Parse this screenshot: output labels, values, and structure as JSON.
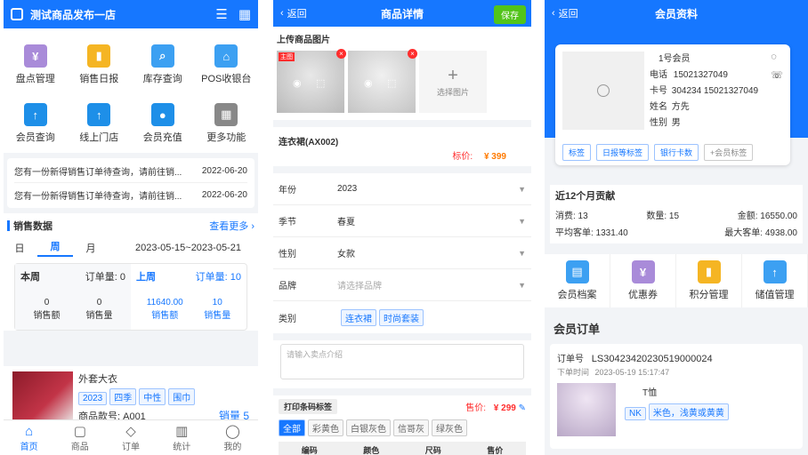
{
  "p1": {
    "title": "测试商品发布一店",
    "grid": [
      {
        "label": "盘点管理",
        "icon": "inventory-icon",
        "color": "#a98bd9",
        "glyph": "¥"
      },
      {
        "label": "销售日报",
        "icon": "daily-report-icon",
        "color": "#f5b523",
        "glyph": "▮"
      },
      {
        "label": "库存查询",
        "icon": "stock-search-icon",
        "color": "#3ca0f2",
        "glyph": "⌕"
      },
      {
        "label": "POS收银台",
        "icon": "pos-icon",
        "color": "#3ca0f2",
        "glyph": "⌂"
      },
      {
        "label": "会员查询",
        "icon": "member-search-icon",
        "color": "#1e8fe8",
        "glyph": "↑"
      },
      {
        "label": "线上门店",
        "icon": "online-store-icon",
        "color": "#1e8fe8",
        "glyph": "↑"
      },
      {
        "label": "会员充值",
        "icon": "recharge-icon",
        "color": "#1e8fe8",
        "glyph": "●"
      },
      {
        "label": "更多功能",
        "icon": "more-icon",
        "color": "#888888",
        "glyph": "▦"
      }
    ],
    "notices": [
      {
        "text": "您有一份新得销售订单待查询，请前往销...",
        "date": "2022-06-20"
      },
      {
        "text": "您有一份新得销售订单待查询，请前往销...",
        "date": "2022-06-20"
      }
    ],
    "sales_title": "销售数据",
    "see_more": "查看更多 ›",
    "tabs": [
      "日",
      "周",
      "月"
    ],
    "range": "2023-05-15~2023-05-21",
    "this_week": "本周",
    "this_week_orders": "订单量: 0",
    "last_week": "上周",
    "last_week_orders": "订单量: 10",
    "stats": [
      {
        "val": "0",
        "lab": "销售额"
      },
      {
        "val": "0",
        "lab": "销售量"
      },
      {
        "val": "11640.00",
        "lab": "销售额"
      },
      {
        "val": "10",
        "lab": "销售量"
      }
    ],
    "product": {
      "name": "外套大衣",
      "tags": [
        "2023",
        "四季",
        "中性",
        "围巾"
      ],
      "code": "商品款号: A001",
      "sales": "销量 5"
    },
    "tabbar": [
      "首页",
      "商品",
      "订单",
      "统计",
      "我的"
    ]
  },
  "p2": {
    "back": "返回",
    "title": "商品详情",
    "save": "保存",
    "upload_title": "上传商品图片",
    "badge": "主图",
    "choose": "选择图片",
    "product_name": "连衣裙(AX002)",
    "price_label": "标价:",
    "price": "¥ 399",
    "fields": [
      {
        "label": "年份",
        "value": "2023"
      },
      {
        "label": "季节",
        "value": "春夏"
      },
      {
        "label": "性别",
        "value": "女款"
      },
      {
        "label": "品牌",
        "value": "请选择品牌"
      }
    ],
    "category_label": "类别",
    "categories": [
      "连衣裙",
      "时尚套装"
    ],
    "intro_placeholder": "请输入卖点介绍",
    "print_label": "打印条码标签",
    "sale_price_label": "售价:",
    "sale_price": "¥ 299",
    "colors": [
      "全部",
      "彩黄色",
      "白银灰色",
      "信哥灰",
      "绿灰色"
    ],
    "table_headers": [
      "编码",
      "颜色",
      "尺码",
      "售价"
    ]
  },
  "p3": {
    "back": "返回",
    "title": "会员资料",
    "card": {
      "name": "1号会员",
      "phone": "15021327049",
      "card": "304234 15021327049",
      "realname": "方先",
      "gender": "男"
    },
    "labels": {
      "phone": "电话",
      "card": "卡号",
      "name": "姓名",
      "gender": "性别"
    },
    "buttons": [
      "标签",
      "日报等标签",
      "银行卡数",
      "+会员标签"
    ],
    "year_title": "近12个月贡献",
    "spend_times": "消费: 13",
    "qty": "数量: 15",
    "amount": "金额: 16550.00",
    "avg": "平均客单: 1331.40",
    "max": "最大客单: 4938.00",
    "grid": [
      {
        "label": "会员档案",
        "icon": "member-file-icon",
        "color": "#3ca0f2",
        "glyph": "▤"
      },
      {
        "label": "优惠券",
        "icon": "coupon-icon",
        "color": "#a98bd9",
        "glyph": "¥"
      },
      {
        "label": "积分管理",
        "icon": "points-icon",
        "color": "#f5b523",
        "glyph": "▮"
      },
      {
        "label": "储值管理",
        "icon": "stored-value-icon",
        "color": "#3ca0f2",
        "glyph": "↑"
      }
    ],
    "orders_title": "会员订单",
    "order_no_label": "订单号",
    "order_no": "LS30423420230519000024",
    "order_time_label": "下单时间",
    "order_time": "2023-05-19 15:17:47",
    "item_name": "T恤",
    "item_tags": [
      "NK",
      "米色，浅黄或黄黄"
    ]
  }
}
